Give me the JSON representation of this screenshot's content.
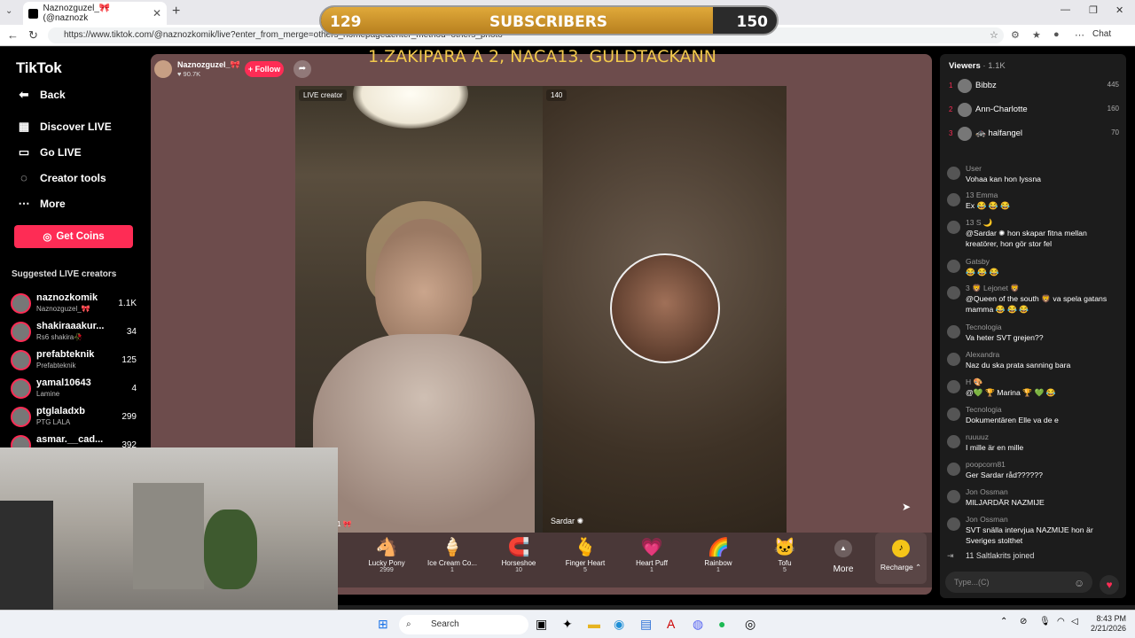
{
  "browser": {
    "tab_title": "Naznozguzel_🎀 (@naznozk",
    "url": "https://www.tiktok.com/@naznozkomik/live?enter_from_merge=others_homepage&enter_method=others_photo",
    "chat_button": "Chat"
  },
  "overlay": {
    "sub_current": "129",
    "sub_label": "SUBSCRIBERS",
    "sub_goal": "150",
    "sub_progress": 0.86,
    "banner_text": "1.ZAKIPARA A 2, NACA13.  GULDTACKANN"
  },
  "sidebar": {
    "logo": "TikTok",
    "back": "Back",
    "nav": [
      "Discover LIVE",
      "Go LIVE",
      "Creator tools",
      "More"
    ],
    "coins_button": "Get Coins",
    "suggested_title": "Suggested LIVE creators",
    "creators": [
      {
        "name": "naznozkomik",
        "sub": "Naznozguzel_🎀",
        "count": "1.1K"
      },
      {
        "name": "shakiraaakur...",
        "sub": "Rs6 shakira🥀",
        "count": "34"
      },
      {
        "name": "prefabteknik",
        "sub": "Prefabteknik",
        "count": "125"
      },
      {
        "name": "yamal10643",
        "sub": "Lamine",
        "count": "4"
      },
      {
        "name": "ptglaladxb",
        "sub": "PTG LALA",
        "count": "299"
      },
      {
        "name": "asmar.__cad...",
        "sub": "",
        "count": "392"
      }
    ]
  },
  "stream": {
    "host_name": "Naznozguzel_🎀",
    "host_likes": "♥ 90.7K",
    "follow": "+ Follow",
    "live_badge": "LIVE creator",
    "viewer_badge": "140",
    "guest_name": "Sardar ✺",
    "left_label": "1 🎀"
  },
  "gifts": [
    {
      "name": "Lucky Pony",
      "price": "2999",
      "icon": "🐴"
    },
    {
      "name": "Ice Cream Co...",
      "price": "1",
      "icon": "🍦"
    },
    {
      "name": "Horseshoe",
      "price": "10",
      "icon": "🧲"
    },
    {
      "name": "Finger Heart",
      "price": "5",
      "icon": "🫰"
    },
    {
      "name": "Heart Puff",
      "price": "1",
      "icon": "💗"
    },
    {
      "name": "Rainbow",
      "price": "1",
      "icon": "🌈"
    },
    {
      "name": "Tofu",
      "price": "5",
      "icon": "🐱"
    }
  ],
  "gift_more": "More",
  "recharge": "Recharge ⌃",
  "chat": {
    "viewers_label": "Viewers",
    "viewers_count": "· 1.1K",
    "top_viewers": [
      {
        "rank": "1",
        "name": "Bibbz",
        "score": "445"
      },
      {
        "rank": "2",
        "name": "Ann-Charlotte",
        "score": "160"
      },
      {
        "rank": "3",
        "name": "🚓 halfangel",
        "score": "70"
      }
    ],
    "messages": [
      {
        "user": "User",
        "text": "Vohaa kan hon lyssna"
      },
      {
        "user": "13 Emma",
        "text": "Ex 😂 😂 😂"
      },
      {
        "user": "13 S 🌙",
        "text": "@Sardar ✺ hon skapar fitna mellan kreatörer, hon gör stor fel"
      },
      {
        "user": "Gatsby",
        "text": "😂 😂 😂"
      },
      {
        "user": "3 🦁 Lejonet 🦁",
        "text": "@Queen of the south 🦁 va spela gatans mamma 😂 😂 😂"
      },
      {
        "user": "Tecnologia",
        "text": "Va heter SVT grejen??"
      },
      {
        "user": "Alexandra",
        "text": "Naz du ska prata sanning bara"
      },
      {
        "user": "H 🎨",
        "text": "@💚 🏆 Marina 🏆 💚 😂"
      },
      {
        "user": "Tecnologia",
        "text": "Dokumentären Elle va de e"
      },
      {
        "user": "ruuuuz",
        "text": "I mille är en mille"
      },
      {
        "user": "poopcorn81",
        "text": "Ger Sardar råd??????"
      },
      {
        "user": "Jon Ossman",
        "text": "MILJARDÄR NAZMIJE"
      },
      {
        "user": "Jon Ossman",
        "text": "SVT snälla intervjua NAZMIJE hon är Sveriges stolthet"
      }
    ],
    "join_notice": "11 Saltlakrits  joined",
    "input_placeholder": "Type...(C)"
  },
  "taskbar": {
    "search": "Search",
    "time": "8:43 PM",
    "date": "2/21/2026"
  }
}
